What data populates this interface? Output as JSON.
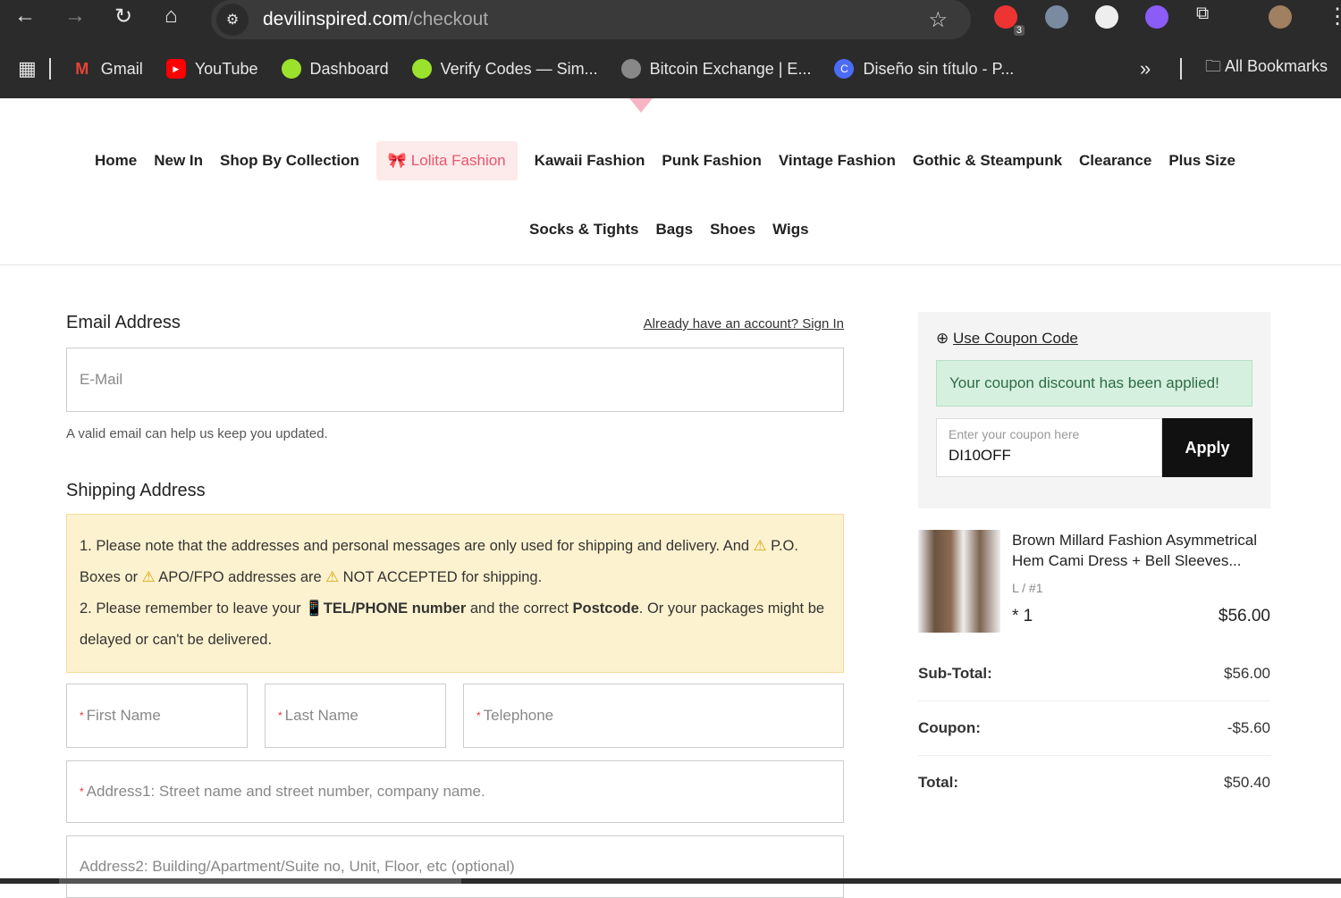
{
  "browser": {
    "url_host": "devilinspired.com",
    "url_path": "/checkout",
    "ext_badge": "3",
    "bookmarks": [
      "Gmail",
      "YouTube",
      "Dashboard",
      "Verify Codes — Sim...",
      "Bitcoin Exchange | E...",
      "Diseño sin título - P..."
    ],
    "more": "»",
    "all_bookmarks": "All Bookmarks"
  },
  "nav": {
    "row1": [
      "Home",
      "New In",
      "Shop By Collection",
      "Lolita Fashion",
      "Kawaii Fashion",
      "Punk Fashion",
      "Vintage Fashion",
      "Gothic & Steampunk",
      "Clearance",
      "Plus Size"
    ],
    "row2": [
      "Socks & Tights",
      "Bags",
      "Shoes",
      "Wigs"
    ]
  },
  "email": {
    "title": "Email Address",
    "signin": "Already have an account? Sign In",
    "placeholder": "E-Mail",
    "help": "A valid email can help us keep you updated."
  },
  "shipping": {
    "title": "Shipping Address",
    "notice1a": "1. Please note that the addresses and personal messages are only used for shipping and delivery. And ",
    "notice1b": "P.O. Boxes or ",
    "notice1c": "APO/FPO addresses are ",
    "notice1d": "NOT ACCEPTED for shipping.",
    "notice2a": "2. Please remember to leave your ",
    "notice2b": "TEL/PHONE number",
    "notice2c": " and the correct ",
    "notice2d": "Postcode",
    "notice2e": ". Or your packages might be delayed or can't be delivered.",
    "first": "First Name",
    "last": "Last Name",
    "tel": "Telephone",
    "addr1": "Address1: Street name and street number, company name.",
    "addr2": "Address2: Building/Apartment/Suite no, Unit, Floor, etc (optional)"
  },
  "coupon": {
    "link": "Use Coupon Code",
    "success": "Your coupon discount has been applied!",
    "placeholder": "Enter your coupon here",
    "value": "DI10OFF",
    "apply": "Apply"
  },
  "item": {
    "name": "Brown Millard Fashion Asymmetrical Hem Cami Dress + Bell Sleeves...",
    "variant": "L / #1",
    "qty": "* 1",
    "price": "$56.00"
  },
  "totals": [
    {
      "label": "Sub-Total:",
      "value": "$56.00"
    },
    {
      "label": "Coupon:",
      "value": "-$5.60"
    },
    {
      "label": "Total:",
      "value": "$50.40"
    }
  ]
}
